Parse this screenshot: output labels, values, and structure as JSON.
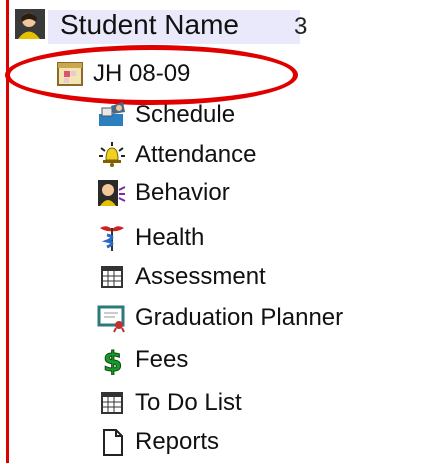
{
  "student": {
    "name": "Student Name",
    "name_extra": "3"
  },
  "term": {
    "label": "JH 08-09"
  },
  "menu": [
    {
      "label": "Schedule",
      "icon": "schedule-icon"
    },
    {
      "label": "Attendance",
      "icon": "attendance-bell-icon"
    },
    {
      "label": "Behavior",
      "icon": "behavior-icon"
    },
    {
      "label": "Health",
      "icon": "health-caduceus-icon"
    },
    {
      "label": "Assessment",
      "icon": "table-grid-icon"
    },
    {
      "label": "Graduation Planner",
      "icon": "certificate-icon"
    },
    {
      "label": "Fees",
      "icon": "dollar-icon"
    },
    {
      "label": "To Do List",
      "icon": "table-grid-icon"
    },
    {
      "label": "Reports",
      "icon": "document-icon"
    }
  ],
  "colors": {
    "accent_red": "#e00000",
    "border_red": "#d90000",
    "header_bg": "#e9e9fb"
  }
}
